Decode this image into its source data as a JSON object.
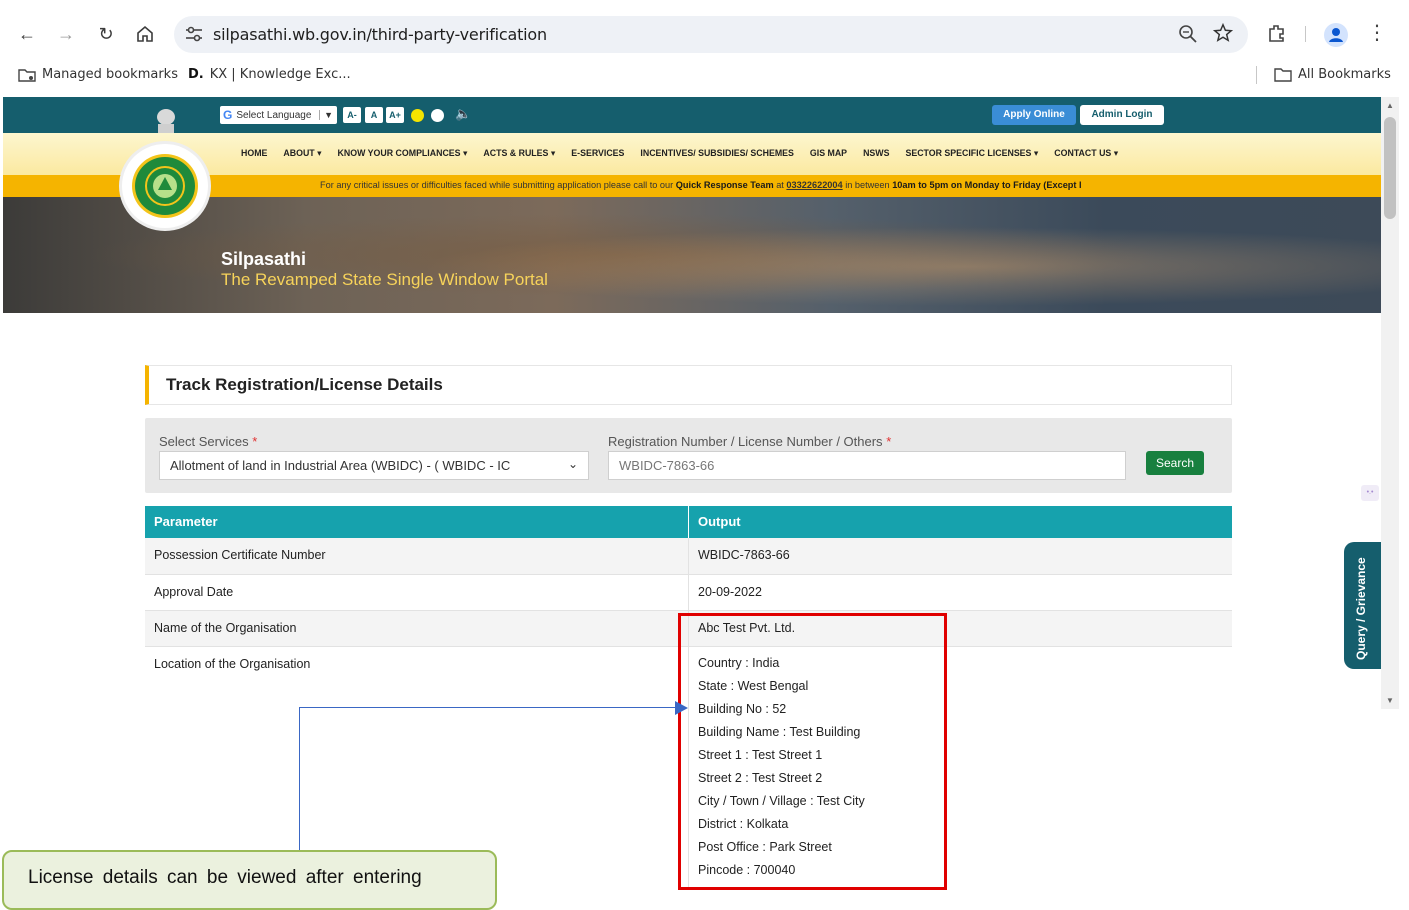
{
  "browser": {
    "url": "silpasathi.wb.gov.in/third-party-verification",
    "bookmarks": [
      {
        "label": "Managed bookmarks",
        "icon": "managed-folder-icon"
      },
      {
        "label": "KX | Knowledge Exc...",
        "icon": "kx-favicon"
      }
    ],
    "all_bookmarks": "All Bookmarks"
  },
  "site": {
    "language_selector": "Select Language",
    "font_controls": [
      "A-",
      "A",
      "A+"
    ],
    "apply_online": "Apply Online",
    "admin_login": "Admin Login",
    "menu": [
      "HOME",
      "ABOUT ▾",
      "KNOW YOUR COMPLIANCES ▾",
      "ACTS & RULES ▾",
      "E-SERVICES",
      "INCENTIVES/ SUBSIDIES/ SCHEMES",
      "GIS MAP",
      "NSWS",
      "SECTOR SPECIFIC LICENSES ▾",
      "CONTACT US ▾"
    ],
    "notice_pre": "For any critical issues or difficulties faced while submitting application please call to our ",
    "notice_team": "Quick Response Team",
    "notice_at": " at ",
    "notice_phone": "03322622004",
    "notice_mid": " in between ",
    "notice_time": "10am to 5pm on Monday to Friday (Except I",
    "hero_title": "Silpasathi",
    "hero_subtitle": "The Revamped State Single Window Portal",
    "grievance": "Query / Grievance"
  },
  "main": {
    "section_title": "Track Registration/License Details",
    "select_services_label": "Select Services",
    "select_services_value": "Allotment of land in Industrial Area (WBIDC) - ( WBIDC - IC",
    "reg_label": "Registration Number / License Number / Others",
    "reg_value": "WBIDC-7863-66",
    "search_button": "Search",
    "required_mark": "*",
    "table": {
      "headers": [
        "Parameter",
        "Output"
      ],
      "rows": [
        {
          "param": "Possession Certificate Number",
          "output": "WBIDC-7863-66"
        },
        {
          "param": "Approval Date",
          "output": "20-09-2022"
        },
        {
          "param": "Name of the Organisation",
          "output": "Abc Test Pvt. Ltd."
        },
        {
          "param": "Location of the Organisation",
          "output": ""
        }
      ],
      "location_lines": [
        "Country : India",
        "State : West Bengal",
        "Building No : 52",
        "Building Name : Test Building",
        "Street 1 : Test Street 1",
        "Street 2 : Test Street 2",
        "City / Town / Village : Test City",
        "District : Kolkata",
        "Post Office : Park Street",
        "Pincode : 700040"
      ]
    }
  },
  "callout": "License details can be viewed after entering",
  "colors": {
    "brand_teal": "#155e6d",
    "table_header": "#16a2ad",
    "notice_bar": "#f5b400",
    "search_green": "#18803f",
    "highlight_red": "#e00000"
  }
}
